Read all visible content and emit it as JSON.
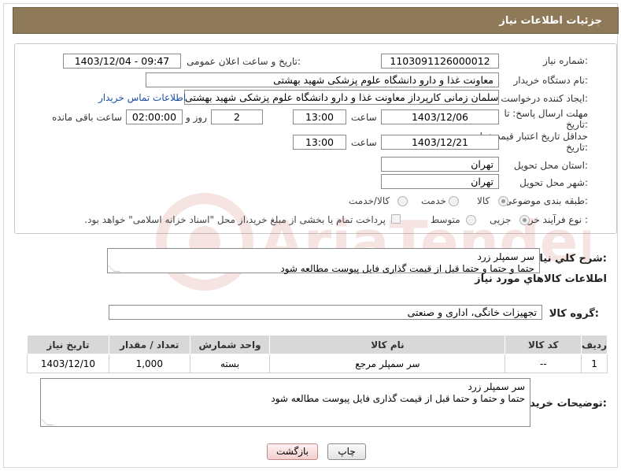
{
  "header": {
    "title": "جزئیات اطلاعات نیاز"
  },
  "form": {
    "need_number": {
      "label": "شماره نیاز:",
      "value": "1103091126000012"
    },
    "announce_datetime": {
      "label": "تاریخ و ساعت اعلان عمومی:",
      "value": "1403/12/04 - 09:47"
    },
    "buyer_org": {
      "label": "نام دستگاه خریدار:",
      "value": "معاونت غذا و دارو دانشگاه علوم پزشکی شهید بهشتی"
    },
    "requester": {
      "label": "ایجاد کننده درخواست:",
      "value": "سلمان زمانی کارپرداز معاونت غذا و دارو دانشگاه علوم پزشکی شهید بهشتی",
      "contact_link": "اطلاعات تماس خریدار"
    },
    "reply_deadline": {
      "label_line1": "مهلت ارسال پاسخ: تا",
      "label_line2": "تاریخ:",
      "date": "1403/12/06",
      "time_label": "ساعت",
      "time": "13:00",
      "days": "2",
      "days_label": "روز و",
      "remaining": "02:00:00",
      "remaining_label": "ساعت باقی مانده"
    },
    "price_validity": {
      "label_line1": "حداقل تاریخ اعتبار قیمت: تا",
      "label_line2": "تاریخ:",
      "date": "1403/12/21",
      "time_label": "ساعت",
      "time": "13:00"
    },
    "province": {
      "label": "استان محل تحویل:",
      "value": "تهران"
    },
    "city": {
      "label": "شهر محل تحویل:",
      "value": "تهران"
    },
    "category": {
      "label": "طبقه بندی موضوعی:",
      "options": [
        "کالا",
        "خدمت",
        "کالا/خدمت"
      ],
      "selected": "کالا"
    },
    "purchase_type": {
      "label": "نوع فرآیند خرید :",
      "options": [
        "جزیی",
        "متوسط"
      ],
      "selected": "جزیی",
      "payment_note": "پرداخت تمام یا بخشی از مبلغ خرید،از محل \"اسناد خزانه اسلامی\" خواهد بود."
    }
  },
  "description": {
    "label": "شرح کلي نياز:",
    "line1": "سر سمپلر زرد",
    "line2": "حتما و حتما و حتما قبل از قیمت گذاری فایل پیوست مطالعه شود"
  },
  "goods_section": {
    "title": "اطلاعات کالاهاي مورد نياز"
  },
  "goods_group": {
    "label": "گروه کالا:",
    "value": "تجهیزات خانگی، اداری و صنعتی"
  },
  "items_table": {
    "headers": [
      "ردیف",
      "کد کالا",
      "نام کالا",
      "واحد شمارش",
      "تعداد / مقدار",
      "تاریخ نیاز"
    ],
    "rows": [
      {
        "row": "1",
        "code": "--",
        "name": "سر سمپلر مرجع",
        "unit": "بسته",
        "qty": "1,000",
        "date": "1403/12/10"
      }
    ]
  },
  "buyer_notes": {
    "label": "توضیحات خریدار:",
    "line1": "سر سمپلر زرد",
    "line2": "حتما و حتما و حتما قبل از قیمت گذاری فایل پیوست مطالعه شود"
  },
  "buttons": {
    "print": "چاپ",
    "back": "بازگشت"
  },
  "watermark": {
    "text": "AriaTender.neT"
  }
}
